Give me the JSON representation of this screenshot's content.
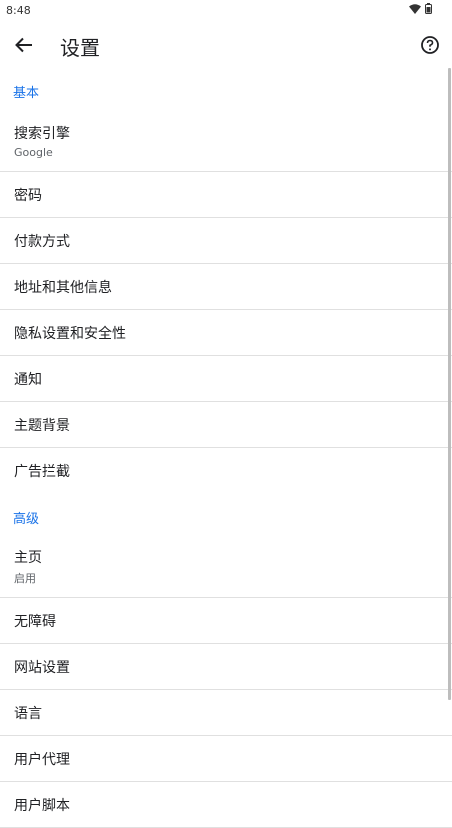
{
  "status": {
    "time": "8:48"
  },
  "app_bar": {
    "title": "设置"
  },
  "sections": [
    {
      "header": "基本",
      "items": [
        {
          "title": "搜索引擎",
          "subtitle": "Google"
        },
        {
          "title": "密码"
        },
        {
          "title": "付款方式"
        },
        {
          "title": "地址和其他信息"
        },
        {
          "title": "隐私设置和安全性"
        },
        {
          "title": "通知"
        },
        {
          "title": "主题背景"
        },
        {
          "title": "广告拦截"
        }
      ]
    },
    {
      "header": "高级",
      "items": [
        {
          "title": "主页",
          "subtitle": "启用"
        },
        {
          "title": "无障碍"
        },
        {
          "title": "网站设置"
        },
        {
          "title": "语言"
        },
        {
          "title": "用户代理"
        },
        {
          "title": "用户脚本"
        }
      ]
    }
  ],
  "colors": {
    "accent": "#1a73e8",
    "divider": "#e0e0e0"
  }
}
